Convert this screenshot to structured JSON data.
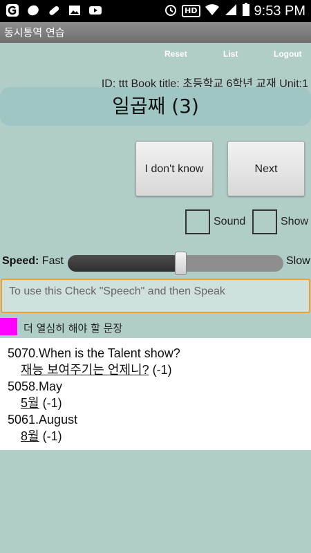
{
  "status_bar": {
    "left_icons": [
      "g-app-icon",
      "blob-icon",
      "pill-icon",
      "image-icon",
      "youtube-icon"
    ],
    "hd": "HD",
    "time": "9:53 PM"
  },
  "app": {
    "title": "동시통역 연습"
  },
  "menu": {
    "reset": "Reset",
    "list": "List",
    "logout": "Logout"
  },
  "info": "ID: ttt  Book title: 초등학교 6학년 교재 Unit:1",
  "prompt": "일곱째 (3)",
  "buttons": {
    "dont_know": "I don't know",
    "next": "Next"
  },
  "checkboxes": {
    "sound": "Sound",
    "show": "Show",
    "sound_checked": false,
    "show_checked": false
  },
  "speed": {
    "label": "Speed:",
    "fast": "Fast",
    "slow": "Slow",
    "value": 0.5
  },
  "speech_input": {
    "placeholder": "To use this Check \"Speech\" and then Speak",
    "value": ""
  },
  "legend": {
    "color": "#ff00ff",
    "text": "더 열심히 해야 할 문장"
  },
  "items": [
    {
      "question": "5070.When is the Talent show?",
      "answer": "재능 보여주기는 언제니?",
      "score": "(-1)"
    },
    {
      "question": "5058.May",
      "answer": "5월",
      "score": "(-1)"
    },
    {
      "question": "5061.August",
      "answer": "8월",
      "score": "(-1)"
    }
  ]
}
